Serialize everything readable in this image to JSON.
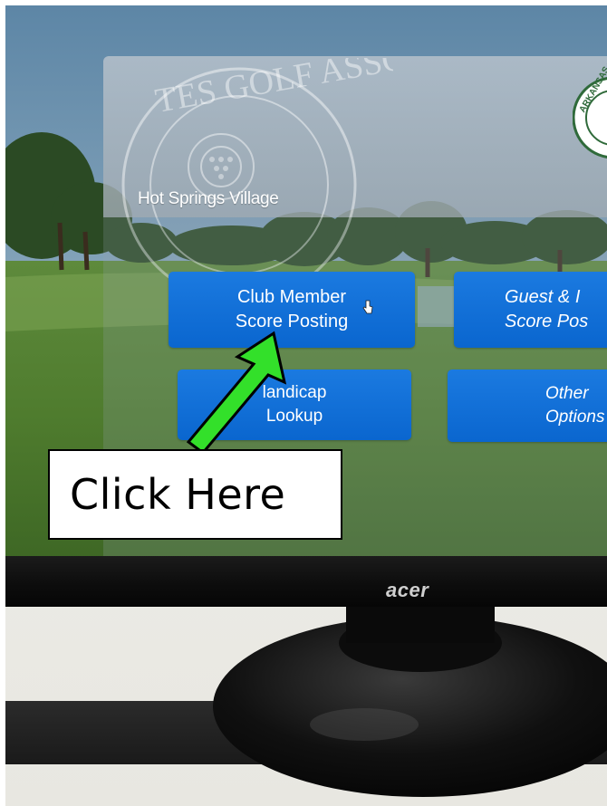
{
  "screen": {
    "club_name": "Hot Springs Village",
    "banner_watermark_text": "TES GOLF ASSOCIAT",
    "state_seal_text": "ARKANSAS ST"
  },
  "menu": {
    "club_member": {
      "line1": "Club Member",
      "line2": "Score Posting"
    },
    "guest": {
      "line1": "Guest & I",
      "line2": "Score Pos"
    },
    "handicap": {
      "line1": "landicap",
      "line2": "Lookup"
    },
    "other": {
      "line1": "Other",
      "line2": "Options"
    }
  },
  "monitor": {
    "brand": "acer"
  },
  "annotation": {
    "callout_text": "Click Here",
    "arrow_color": "#33e02a"
  },
  "colors": {
    "button_blue": "#0a66cf",
    "bezel": "#0d0d0d"
  }
}
